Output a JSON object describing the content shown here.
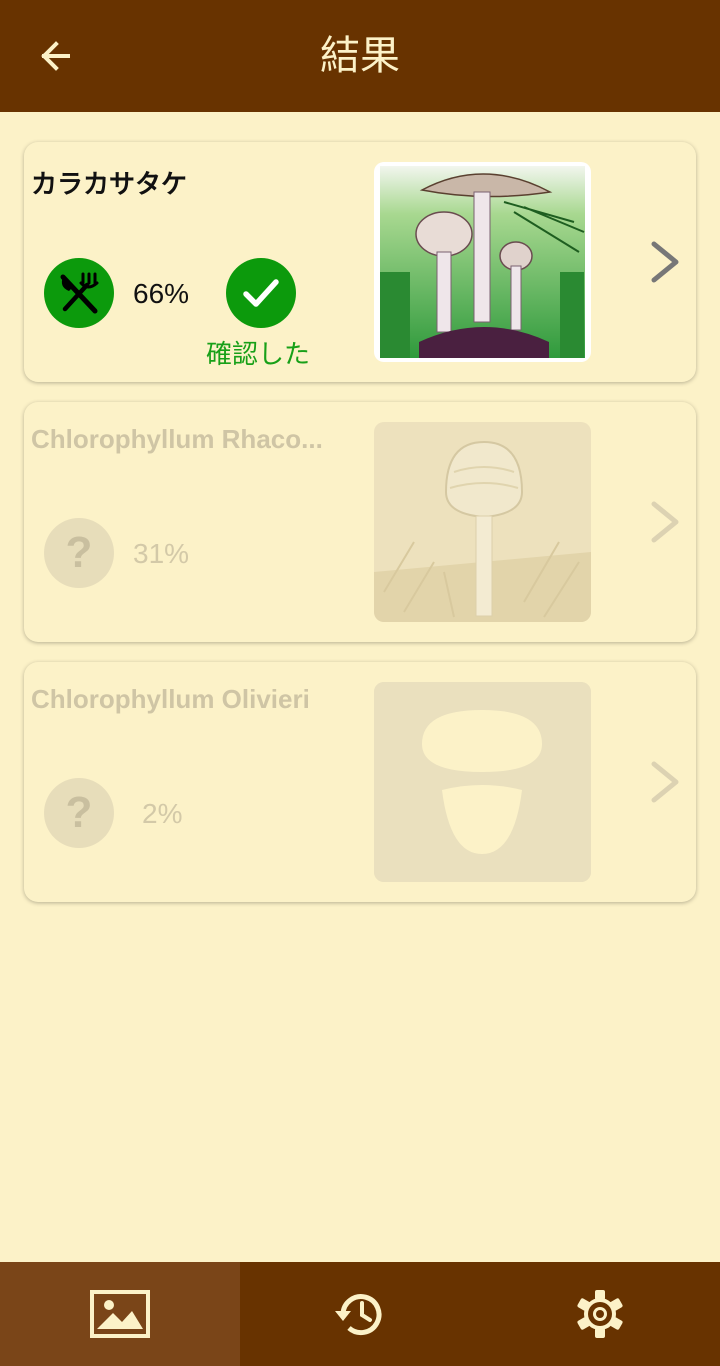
{
  "appbar": {
    "title": "結果",
    "back_icon": "arrow-left-icon"
  },
  "results": [
    {
      "name": "カラカサタケ",
      "percent": "66%",
      "edibility_icon": "fork-knife-icon",
      "verified_icon": "check-icon",
      "verified_label": "確認した",
      "faded": false
    },
    {
      "name": "Chlorophyllum Rhaco...",
      "percent": "31%",
      "edibility_icon": "question-icon",
      "faded": true
    },
    {
      "name": "Chlorophyllum Olivieri",
      "percent": "2%",
      "edibility_icon": "question-icon",
      "faded": true
    }
  ],
  "bottom_nav": [
    {
      "icon": "image-icon",
      "active": true
    },
    {
      "icon": "history-icon",
      "active": false
    },
    {
      "icon": "settings-gear-icon",
      "active": false
    }
  ],
  "colors": {
    "primary": "#683300",
    "background": "#FCF2C8",
    "edible_green": "#0C9A0C",
    "verified_text": "#18A018",
    "faded_grey": "#CFC5A5"
  }
}
